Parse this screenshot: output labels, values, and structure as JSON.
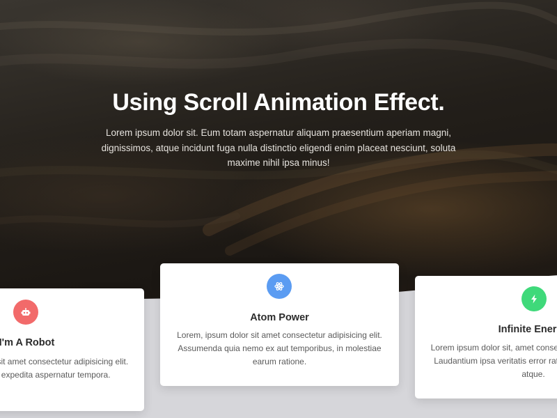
{
  "hero": {
    "title": "Using Scroll Animation Effect.",
    "text": "Lorem ipsum dolor sit. Eum totam aspernatur aliquam praesentium aperiam magni, dignissimos, atque incidunt fuga nulla distinctio eligendi enim placeat nesciunt, soluta maxime nihil ipsa minus!"
  },
  "cards": [
    {
      "icon": "robot-icon",
      "color": "#f26a6a",
      "title": "I'm A Robot",
      "text": "Lorem ipsum dolor sit amet consectetur adipisicing elit. Autem maxime expedita aspernatur tempora."
    },
    {
      "icon": "atom-icon",
      "color": "#5b9cf2",
      "title": "Atom Power",
      "text": "Lorem, ipsum dolor sit amet consectetur adipisicing elit. Assumenda quia nemo ex aut temporibus, in molestiae earum ratione."
    },
    {
      "icon": "bolt-icon",
      "color": "#3fd97a",
      "title": "Infinite Energy",
      "text": "Lorem ipsum dolor sit, amet consectetur adipisicing elit. Laudantium ipsa veritatis error ratione doloribus quasi atque."
    }
  ]
}
